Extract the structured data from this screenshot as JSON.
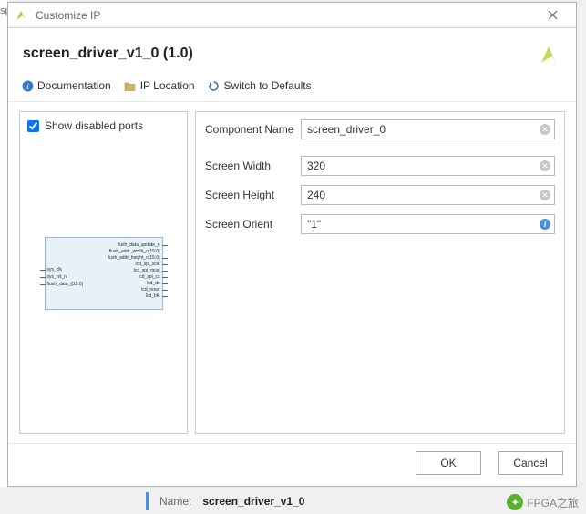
{
  "window": {
    "title": "Customize IP"
  },
  "header": {
    "component_title": "screen_driver_v1_0 (1.0)"
  },
  "toolbar": {
    "doc_label": "Documentation",
    "loc_label": "IP Location",
    "reset_label": "Switch to Defaults"
  },
  "left_panel": {
    "show_disabled_label": "Show disabled ports",
    "show_disabled_checked": true,
    "block_ports_left": [
      "sys_clk",
      "sys_rst_n",
      "flush_data_i[15:0]"
    ],
    "block_ports_right": [
      "flush_data_update_o",
      "flush_addr_width_o[15:0]",
      "flush_addr_height_o[15:0]",
      "lcd_spi_sclk",
      "lcd_spi_mosi",
      "lcd_spi_cs",
      "lcd_dc",
      "lcd_reset",
      "lcd_blk"
    ]
  },
  "form": {
    "component_name_label": "Component Name",
    "component_name_value": "screen_driver_0",
    "screen_width_label": "Screen Width",
    "screen_width_value": "320",
    "screen_height_label": "Screen Height",
    "screen_height_value": "240",
    "screen_orient_label": "Screen Orient",
    "screen_orient_value": "\"1\""
  },
  "buttons": {
    "ok": "OK",
    "cancel": "Cancel"
  },
  "bottom": {
    "name_label": "Name:",
    "name_value": "screen_driver_v1_0"
  },
  "watermark": {
    "text": "FPGA之旅"
  },
  "left_crop_text": "sp"
}
